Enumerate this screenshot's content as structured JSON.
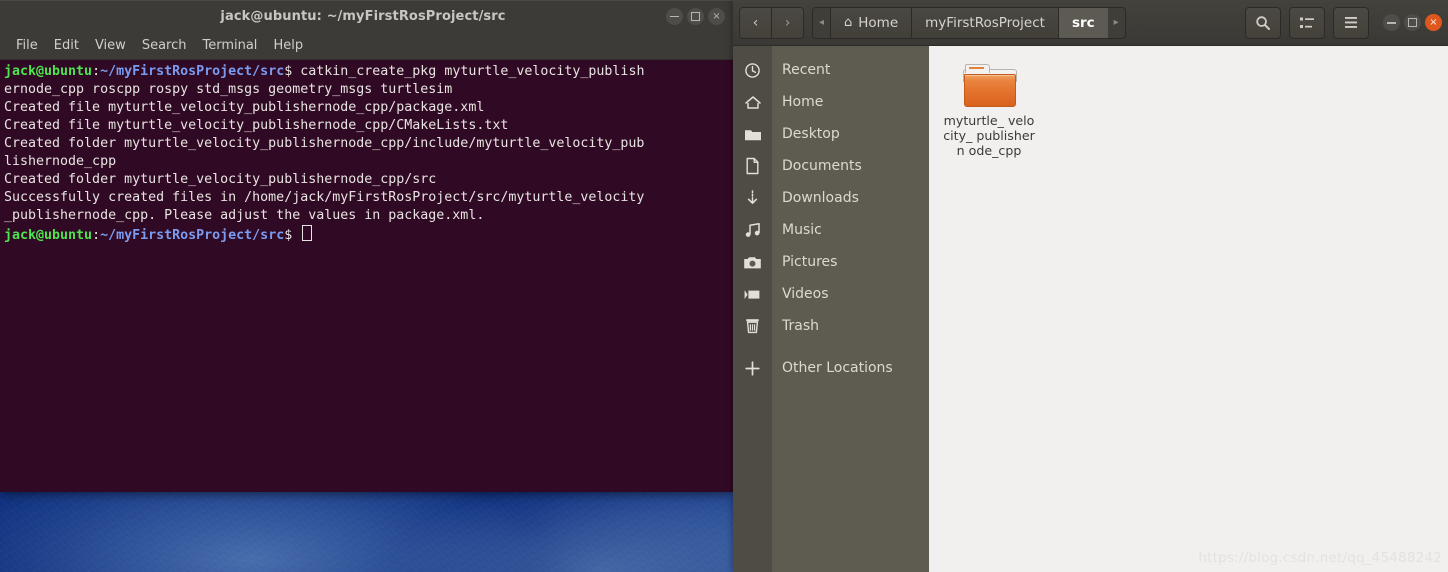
{
  "terminal": {
    "title": "jack@ubuntu: ~/myFirstRosProject/src",
    "menu": [
      "File",
      "Edit",
      "View",
      "Search",
      "Terminal",
      "Help"
    ],
    "prompt_user": "jack@ubuntu",
    "prompt_colon": ":",
    "prompt_path": "~/myFirstRosProject/src",
    "prompt_dollar": "$ ",
    "lines": [
      {
        "type": "prompt",
        "command": "catkin_create_pkg myturtle_velocity_publish"
      },
      {
        "type": "output",
        "text": "ernode_cpp roscpp rospy std_msgs geometry_msgs turtlesim"
      },
      {
        "type": "output",
        "text": "Created file myturtle_velocity_publishernode_cpp/package.xml"
      },
      {
        "type": "output",
        "text": "Created file myturtle_velocity_publishernode_cpp/CMakeLists.txt"
      },
      {
        "type": "output",
        "text": "Created folder myturtle_velocity_publishernode_cpp/include/myturtle_velocity_pub"
      },
      {
        "type": "output",
        "text": "lishernode_cpp"
      },
      {
        "type": "output",
        "text": "Created folder myturtle_velocity_publishernode_cpp/src"
      },
      {
        "type": "output",
        "text": "Successfully created files in /home/jack/myFirstRosProject/src/myturtle_velocity"
      },
      {
        "type": "output",
        "text": "_publishernode_cpp. Please adjust the values in package.xml."
      },
      {
        "type": "prompt_cursor",
        "command": ""
      }
    ],
    "window_buttons": {
      "minimize": "minimize-icon",
      "maximize": "maximize-icon",
      "close": "×"
    },
    "colors": {
      "background": "#300a24",
      "titlebar": "#3c3b37",
      "prompt_user": "#4ee44e",
      "prompt_path": "#7b9bf0",
      "text": "#e8e4e1"
    }
  },
  "files": {
    "nav": {
      "back": "‹",
      "forward": "›"
    },
    "breadcrumb": {
      "left_arrow": "◂",
      "right_arrow": "▸",
      "items": [
        {
          "label": "Home",
          "icon": "home-icon",
          "active": false
        },
        {
          "label": "myFirstRosProject",
          "icon": "",
          "active": false
        },
        {
          "label": "src",
          "icon": "",
          "active": true
        }
      ]
    },
    "toolbar": [
      {
        "name": "search-icon",
        "label": ""
      },
      {
        "name": "view-options-icon",
        "label": ""
      },
      {
        "name": "hamburger-menu-icon",
        "label": ""
      }
    ],
    "window_buttons": {
      "minimize": "minimize-icon",
      "maximize": "maximize-icon",
      "close": "×",
      "close_color": "#e0561f"
    },
    "sidebar": [
      {
        "label": "Recent",
        "icon": "clock-icon"
      },
      {
        "label": "Home",
        "icon": "home-icon"
      },
      {
        "label": "Desktop",
        "icon": "folder-icon"
      },
      {
        "label": "Documents",
        "icon": "document-icon"
      },
      {
        "label": "Downloads",
        "icon": "download-icon"
      },
      {
        "label": "Music",
        "icon": "music-note-icon"
      },
      {
        "label": "Pictures",
        "icon": "camera-icon"
      },
      {
        "label": "Videos",
        "icon": "video-camera-icon"
      },
      {
        "label": "Trash",
        "icon": "trash-icon"
      },
      {
        "label": "Other Locations",
        "icon": "plus-icon"
      }
    ],
    "items": [
      {
        "name": "myturtle_velocity_publishernode_cpp",
        "display": "myturtle_\nvelocity_\npublishern\node_cpp",
        "icon": "folder-icon"
      }
    ],
    "colors": {
      "headerbar": "#3b3935",
      "sidebar": "#5e5c51",
      "content": "#f1f0ee",
      "folder": "#e2722c"
    }
  },
  "watermark": "https://blog.csdn.net/qq_45488242"
}
